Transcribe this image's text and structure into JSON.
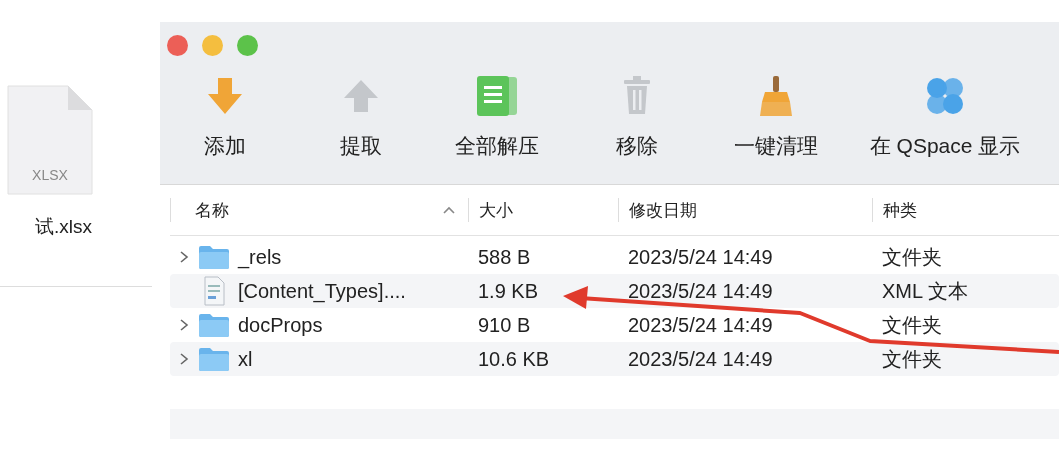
{
  "desktop_file": {
    "badge": "XLSX",
    "name": "试.xlsx"
  },
  "window": {
    "toolbar": [
      {
        "label": "添加",
        "disabled": false
      },
      {
        "label": "提取",
        "disabled": true
      },
      {
        "label": "全部解压",
        "disabled": false
      },
      {
        "label": "移除",
        "disabled": true
      },
      {
        "label": "一键清理",
        "disabled": false
      },
      {
        "label": "在 QSpace 显示",
        "disabled": false
      }
    ],
    "table": {
      "columns": [
        "名称",
        "大小",
        "修改日期",
        "种类"
      ],
      "rows": [
        {
          "kind": "folder",
          "name": "_rels",
          "size": "588 B",
          "modified": "2023/5/24 14:49",
          "type": "文件夹"
        },
        {
          "kind": "file",
          "name": "[Content_Types]....",
          "size": "1.9 KB",
          "modified": "2023/5/24 14:49",
          "type": "XML 文本"
        },
        {
          "kind": "folder",
          "name": "docProps",
          "size": "910 B",
          "modified": "2023/5/24 14:49",
          "type": "文件夹"
        },
        {
          "kind": "folder",
          "name": "xl",
          "size": "10.6 KB",
          "modified": "2023/5/24 14:49",
          "type": "文件夹"
        }
      ]
    }
  }
}
